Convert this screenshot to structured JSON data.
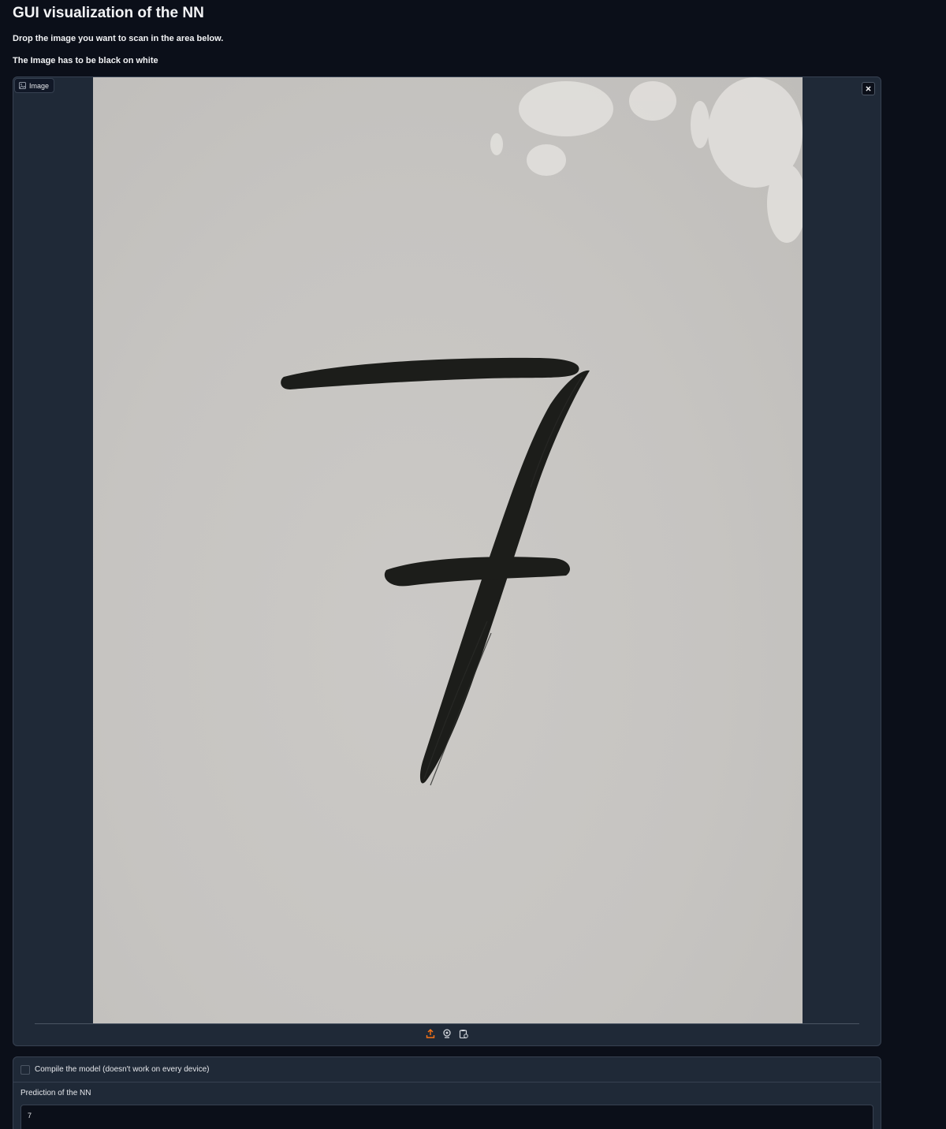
{
  "header": {
    "title": "GUI visualization of the NN",
    "instruction": "Drop the image you want to scan in the area below.",
    "note": "The Image has to be black on white"
  },
  "image_input": {
    "label": "Image",
    "clear_icon": "close-icon",
    "sources": [
      {
        "name": "upload",
        "icon": "upload-icon"
      },
      {
        "name": "webcam",
        "icon": "webcam-icon"
      },
      {
        "name": "clipboard",
        "icon": "clipboard-icon"
      }
    ],
    "accent_color": "#f97316"
  },
  "compile_option": {
    "label": "Compile the model (doesn't work on every device)",
    "checked": false
  },
  "prediction": {
    "label": "Prediction of the NN",
    "value": "7"
  },
  "colors": {
    "background": "#0b0f19",
    "panel": "#1f2937",
    "border": "#374151"
  }
}
